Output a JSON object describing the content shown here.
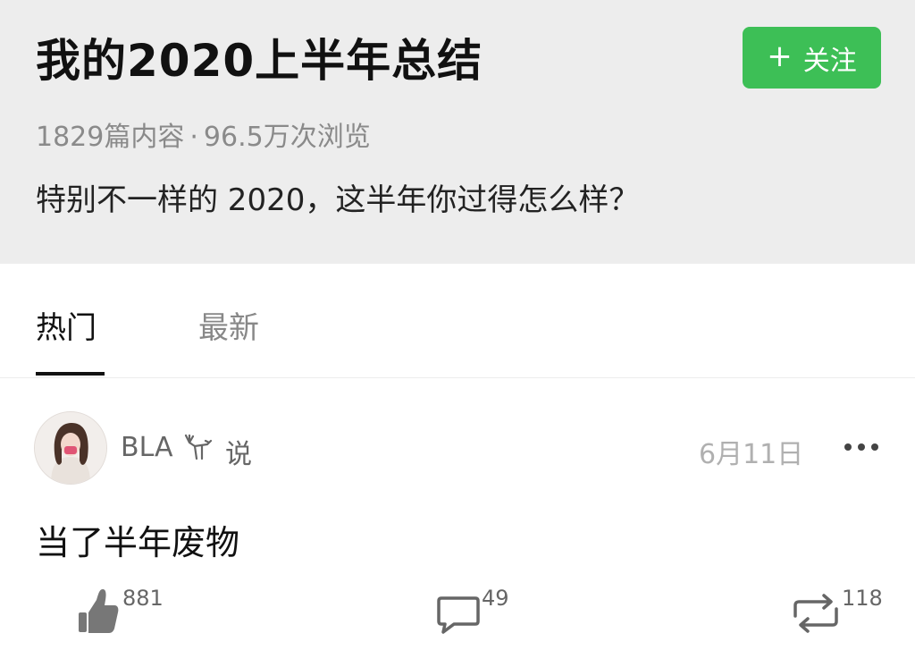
{
  "topic": {
    "title": "我的2020上半年总结",
    "follow_label": "关注",
    "stats_articles": "1829篇内容",
    "stats_separator": "·",
    "stats_views": "96.5万次浏览",
    "description": "特别不一样的 2020，这半年你过得怎么样？"
  },
  "tabs": [
    {
      "label": "热门",
      "active": true
    },
    {
      "label": "最新",
      "active": false
    }
  ],
  "post": {
    "username": "BLA",
    "says": "说",
    "date": "6月11日",
    "text": "当了半年废物",
    "likes": "881",
    "comments": "49",
    "reposts": "118"
  },
  "icons": [
    "plus-icon",
    "deer-icon",
    "more-icon",
    "thumbs-up-icon",
    "comment-icon",
    "repost-icon"
  ],
  "colors": {
    "accent": "#3dbf56",
    "header_bg": "#ededed"
  }
}
